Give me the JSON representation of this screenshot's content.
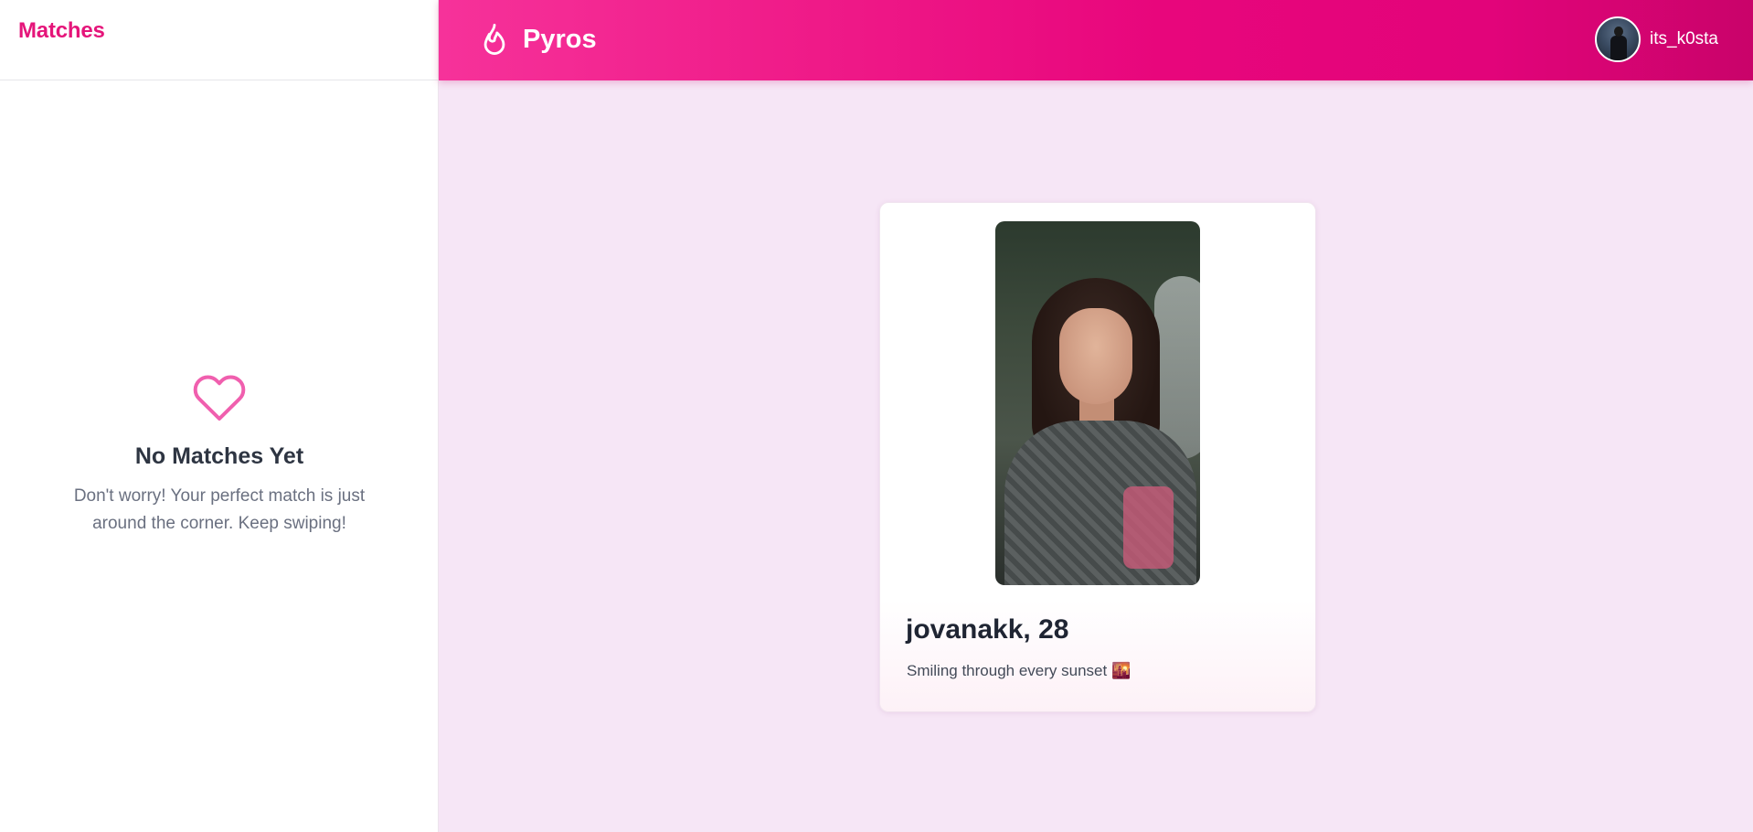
{
  "sidebar": {
    "title": "Matches",
    "empty_state": {
      "icon": "heart-icon",
      "title": "No Matches Yet",
      "message": "Don't worry! Your perfect match is just around the corner. Keep swiping!"
    }
  },
  "header": {
    "brand_icon": "flame-icon",
    "brand_name": "Pyros",
    "user": {
      "username": "its_k0sta"
    }
  },
  "profile_card": {
    "name_age": "jovanakk, 28",
    "bio": "Smiling through every sunset 🌇"
  },
  "colors": {
    "accent": "#e5157a",
    "header_gradient_start": "#f6329a",
    "header_gradient_end": "#c9036a",
    "background": "#f6e6f6"
  }
}
